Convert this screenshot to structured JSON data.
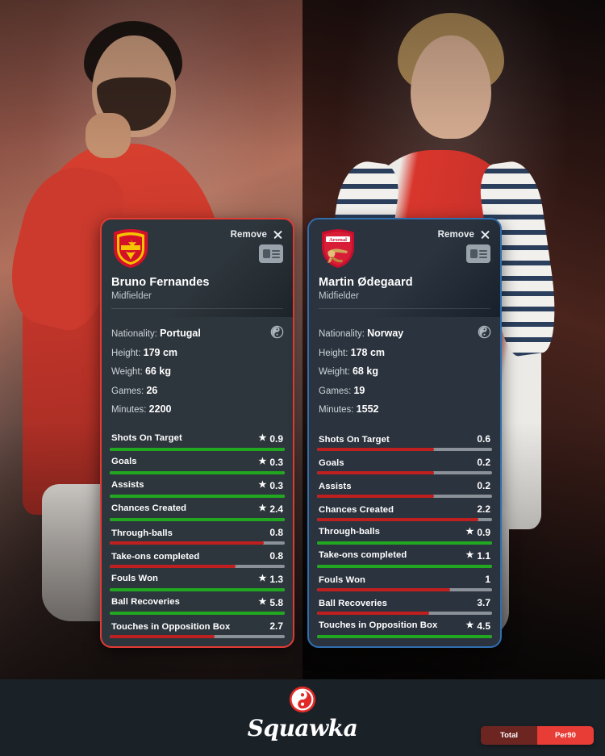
{
  "cards": [
    {
      "accent_color": "#e33b34",
      "team": "Manchester United",
      "crest_icon": "manchester-united-crest",
      "remove_label": "Remove",
      "close_icon": "close-icon",
      "id_card_icon": "player-profile-icon",
      "player_name": "Bruno Fernandes",
      "position": "Midfielder",
      "bio": [
        {
          "label": "Nationality:",
          "value": "Portugal"
        },
        {
          "label": "Height:",
          "value": "179 cm"
        },
        {
          "label": "Weight:",
          "value": "66 kg"
        },
        {
          "label": "Games:",
          "value": "26"
        },
        {
          "label": "Minutes:",
          "value": "2200"
        }
      ],
      "badge_icon": "squawka-yinyang-icon",
      "stats": [
        {
          "name": "Shots On Target",
          "value": "0.9",
          "winner": true,
          "pct": 100,
          "color": "#22a820"
        },
        {
          "name": "Goals",
          "value": "0.3",
          "winner": true,
          "pct": 100,
          "color": "#22a820"
        },
        {
          "name": "Assists",
          "value": "0.3",
          "winner": true,
          "pct": 100,
          "color": "#22a820"
        },
        {
          "name": "Chances Created",
          "value": "2.4",
          "winner": true,
          "pct": 100,
          "color": "#22a820"
        },
        {
          "name": "Through-balls",
          "value": "0.8",
          "winner": false,
          "pct": 88,
          "color": "#c01f1f"
        },
        {
          "name": "Take-ons completed",
          "value": "0.8",
          "winner": false,
          "pct": 72,
          "color": "#c01f1f"
        },
        {
          "name": "Fouls Won",
          "value": "1.3",
          "winner": true,
          "pct": 100,
          "color": "#22a820"
        },
        {
          "name": "Ball Recoveries",
          "value": "5.8",
          "winner": true,
          "pct": 100,
          "color": "#22a820"
        },
        {
          "name": "Touches in Opposition Box",
          "value": "2.7",
          "winner": false,
          "pct": 60,
          "color": "#c01f1f"
        }
      ]
    },
    {
      "accent_color": "#2f6fb0",
      "team": "Arsenal",
      "crest_icon": "arsenal-crest",
      "remove_label": "Remove",
      "close_icon": "close-icon",
      "id_card_icon": "player-profile-icon",
      "player_name": "Martin Ødegaard",
      "position": "Midfielder",
      "bio": [
        {
          "label": "Nationality:",
          "value": "Norway"
        },
        {
          "label": "Height:",
          "value": "178 cm"
        },
        {
          "label": "Weight:",
          "value": "68 kg"
        },
        {
          "label": "Games:",
          "value": "19"
        },
        {
          "label": "Minutes:",
          "value": "1552"
        }
      ],
      "badge_icon": "squawka-yinyang-icon",
      "stats": [
        {
          "name": "Shots On Target",
          "value": "0.6",
          "winner": false,
          "pct": 67,
          "color": "#c01f1f"
        },
        {
          "name": "Goals",
          "value": "0.2",
          "winner": false,
          "pct": 67,
          "color": "#c01f1f"
        },
        {
          "name": "Assists",
          "value": "0.2",
          "winner": false,
          "pct": 67,
          "color": "#c01f1f"
        },
        {
          "name": "Chances Created",
          "value": "2.2",
          "winner": false,
          "pct": 92,
          "color": "#c01f1f"
        },
        {
          "name": "Through-balls",
          "value": "0.9",
          "winner": true,
          "pct": 100,
          "color": "#22a820"
        },
        {
          "name": "Take-ons completed",
          "value": "1.1",
          "winner": true,
          "pct": 100,
          "color": "#22a820"
        },
        {
          "name": "Fouls Won",
          "value": "1",
          "winner": false,
          "pct": 76,
          "color": "#c01f1f"
        },
        {
          "name": "Ball Recoveries",
          "value": "3.7",
          "winner": false,
          "pct": 64,
          "color": "#c01f1f"
        },
        {
          "name": "Touches in Opposition Box",
          "value": "4.5",
          "winner": true,
          "pct": 100,
          "color": "#22a820"
        }
      ]
    }
  ],
  "brand": {
    "logo_icon": "squawka-logo-icon",
    "name": "Squawka"
  },
  "mode_toggle": {
    "options": [
      "Total",
      "Per90"
    ],
    "selected": "Per90"
  }
}
